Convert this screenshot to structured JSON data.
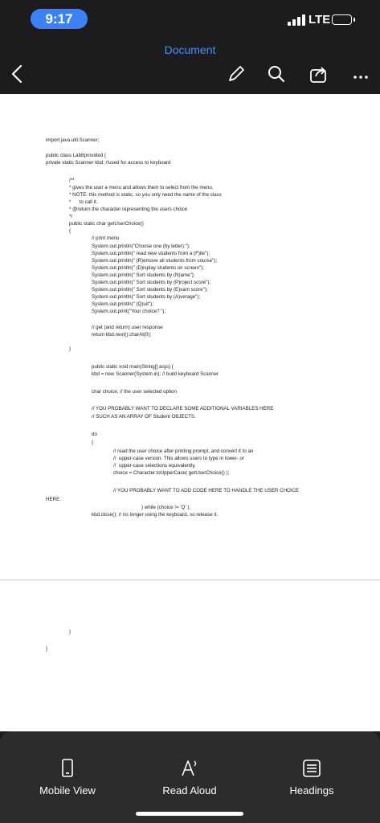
{
  "status_bar": {
    "time": "9:17",
    "network": "LTE"
  },
  "header": {
    "title": "Document"
  },
  "toolbar_icons": [
    "back-icon",
    "edit-pencil-icon",
    "search-icon",
    "share-icon",
    "more-icon"
  ],
  "document": {
    "lines": [
      "import java.util.Scanner;",
      "public class Lab8provided {",
      "private static Scanner kbd; //used for access to keyboard",
      "/**",
      "* gives the user a menu and allows them to select from the menu.",
      "* NOTE: this method is static, so you only need the name of the class",
      "*      to call it.",
      "* @return the character representing the users choice",
      "*/",
      "public static char getUserChoice()",
      "{",
      "// print menu",
      "System.out.println(\"Choose one (by letter):\");",
      "System.out.println(\" read new students from a (F)ile\");",
      "System.out.println(\" (R)emove all students from course\");",
      "System.out.println(\" (D)isplay students on screen\");",
      "System.out.println(\" Sort students by (N)ame\");",
      "System.out.println(\" Sort students by (P)roject score\");",
      "System.out.println(\" Sort students by (E)xam score\");",
      "System.out.println(\" Sort students by (A)verage\");",
      "System.out.println(\" (Q)uit\");",
      "System.out.print(\"Your choice? \");",
      "// get (and return) user response",
      "return kbd.next().charAt(0);",
      "}",
      "public static void main(String[] args) {",
      "kbd = new Scanner(System.in); // build keyboard Scanner",
      "char choice; // the user selected option",
      "// YOU PROBABLY WANT TO DECLARE SOME ADDITIONAL VARIABLES HERE",
      "// SUCH AS AN ARRAY OF Student OBJECTS.",
      "do",
      "{",
      "// read the user choice after printing prompt, and convert it to an",
      "//  upper-case version. This allows users to type in lower- or",
      "//  upper-case selections equivalently.",
      "choice = Character.toUpperCase( getUserChoice() );",
      "// YOU PROBABLY WANT TO ADD CODE HERE TO HANDLE THE USER CHOICE",
      "HERE.",
      "} while (choice != 'Q' );",
      "kbd.close(); // no longer using the keyboard, so release it.",
      "}",
      "}"
    ]
  },
  "bottom_bar": {
    "mobile_view": "Mobile View",
    "read_aloud": "Read Aloud",
    "headings": "Headings"
  }
}
